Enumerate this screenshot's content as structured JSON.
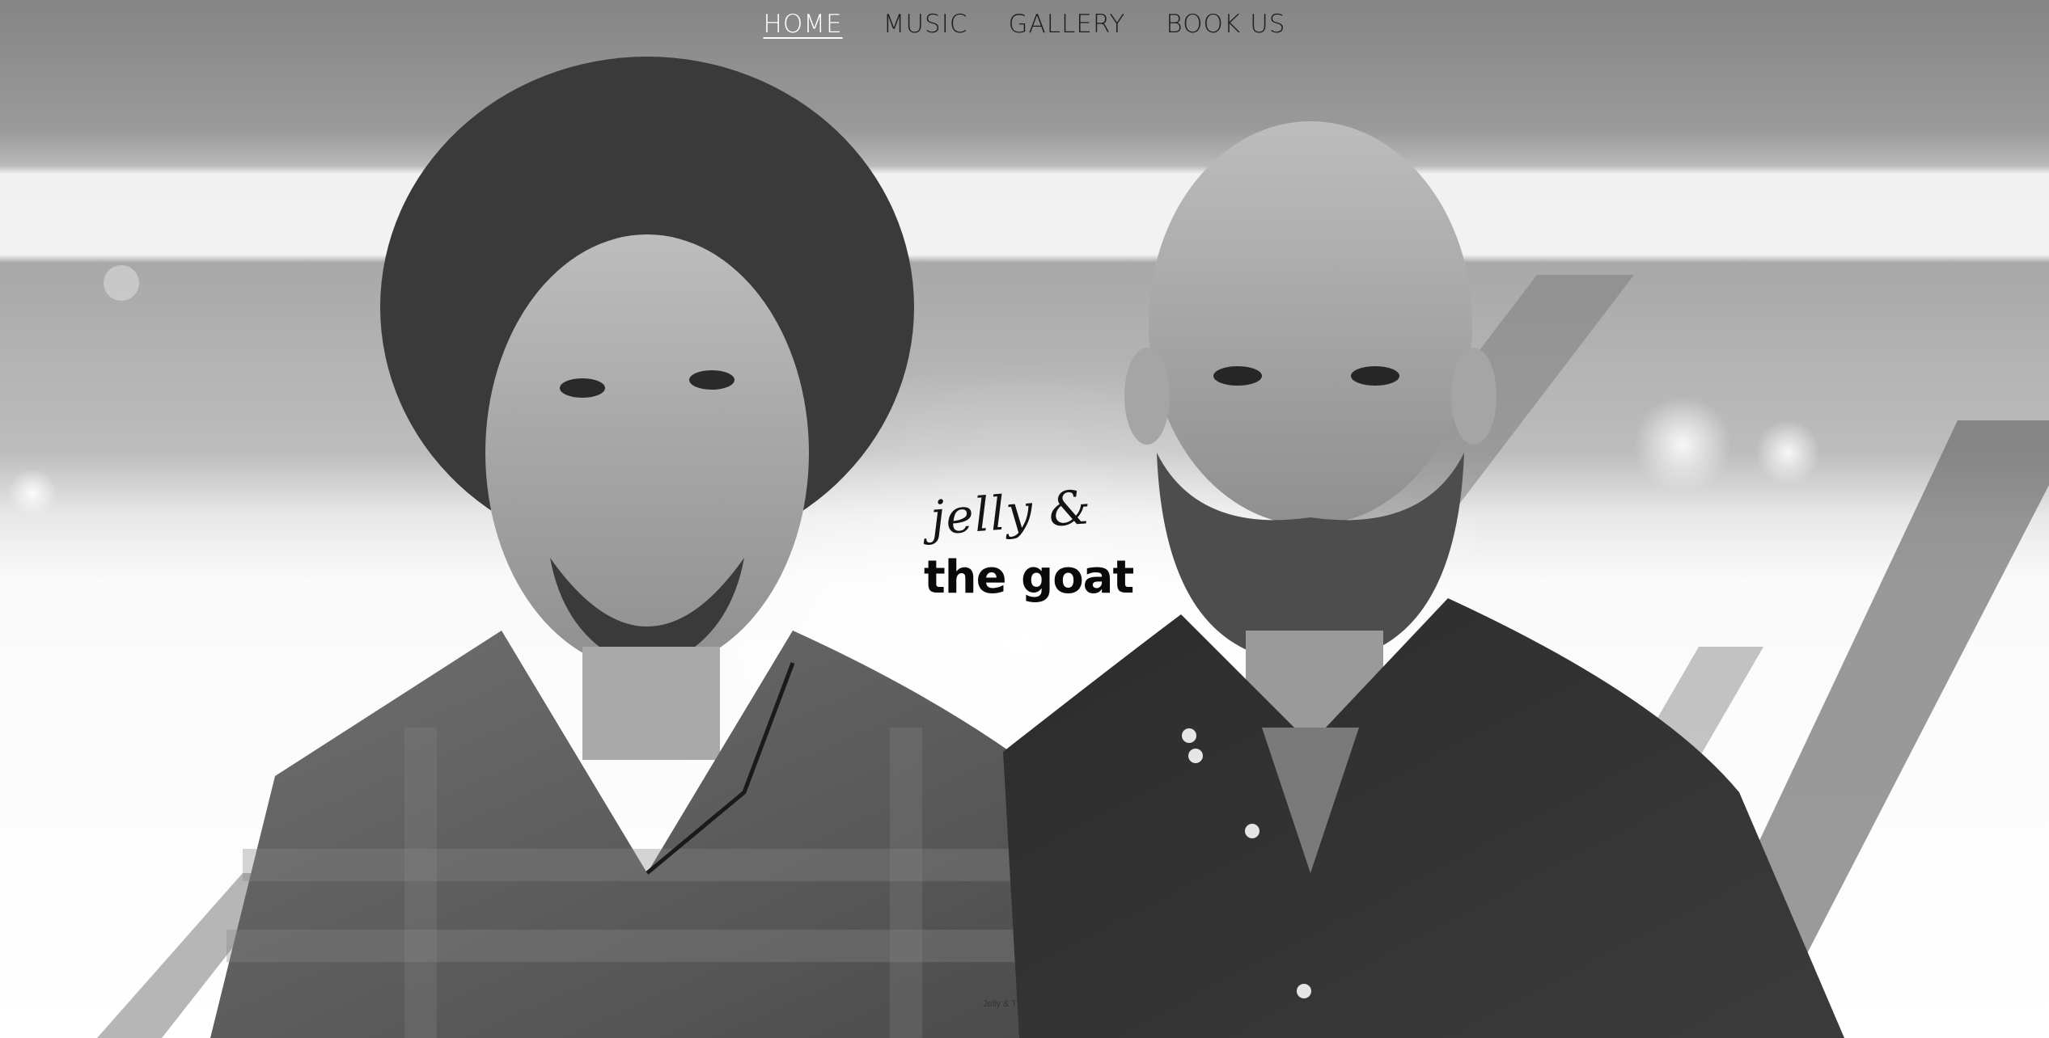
{
  "nav": {
    "items": [
      {
        "label": "HOME",
        "active": true
      },
      {
        "label": "MUSIC",
        "active": false
      },
      {
        "label": "GALLERY",
        "active": false
      },
      {
        "label": "BOOK US",
        "active": false
      }
    ]
  },
  "logo": {
    "line1": "jelly &",
    "line2": "the goat"
  },
  "hero": {
    "image": "black-and-white-band-portrait-photo",
    "caption": "Jelly & The Goat"
  },
  "colors": {
    "nav_text": "#1d1d1d",
    "nav_active": "#ffffff",
    "logo_text": "#0a0a0a"
  }
}
